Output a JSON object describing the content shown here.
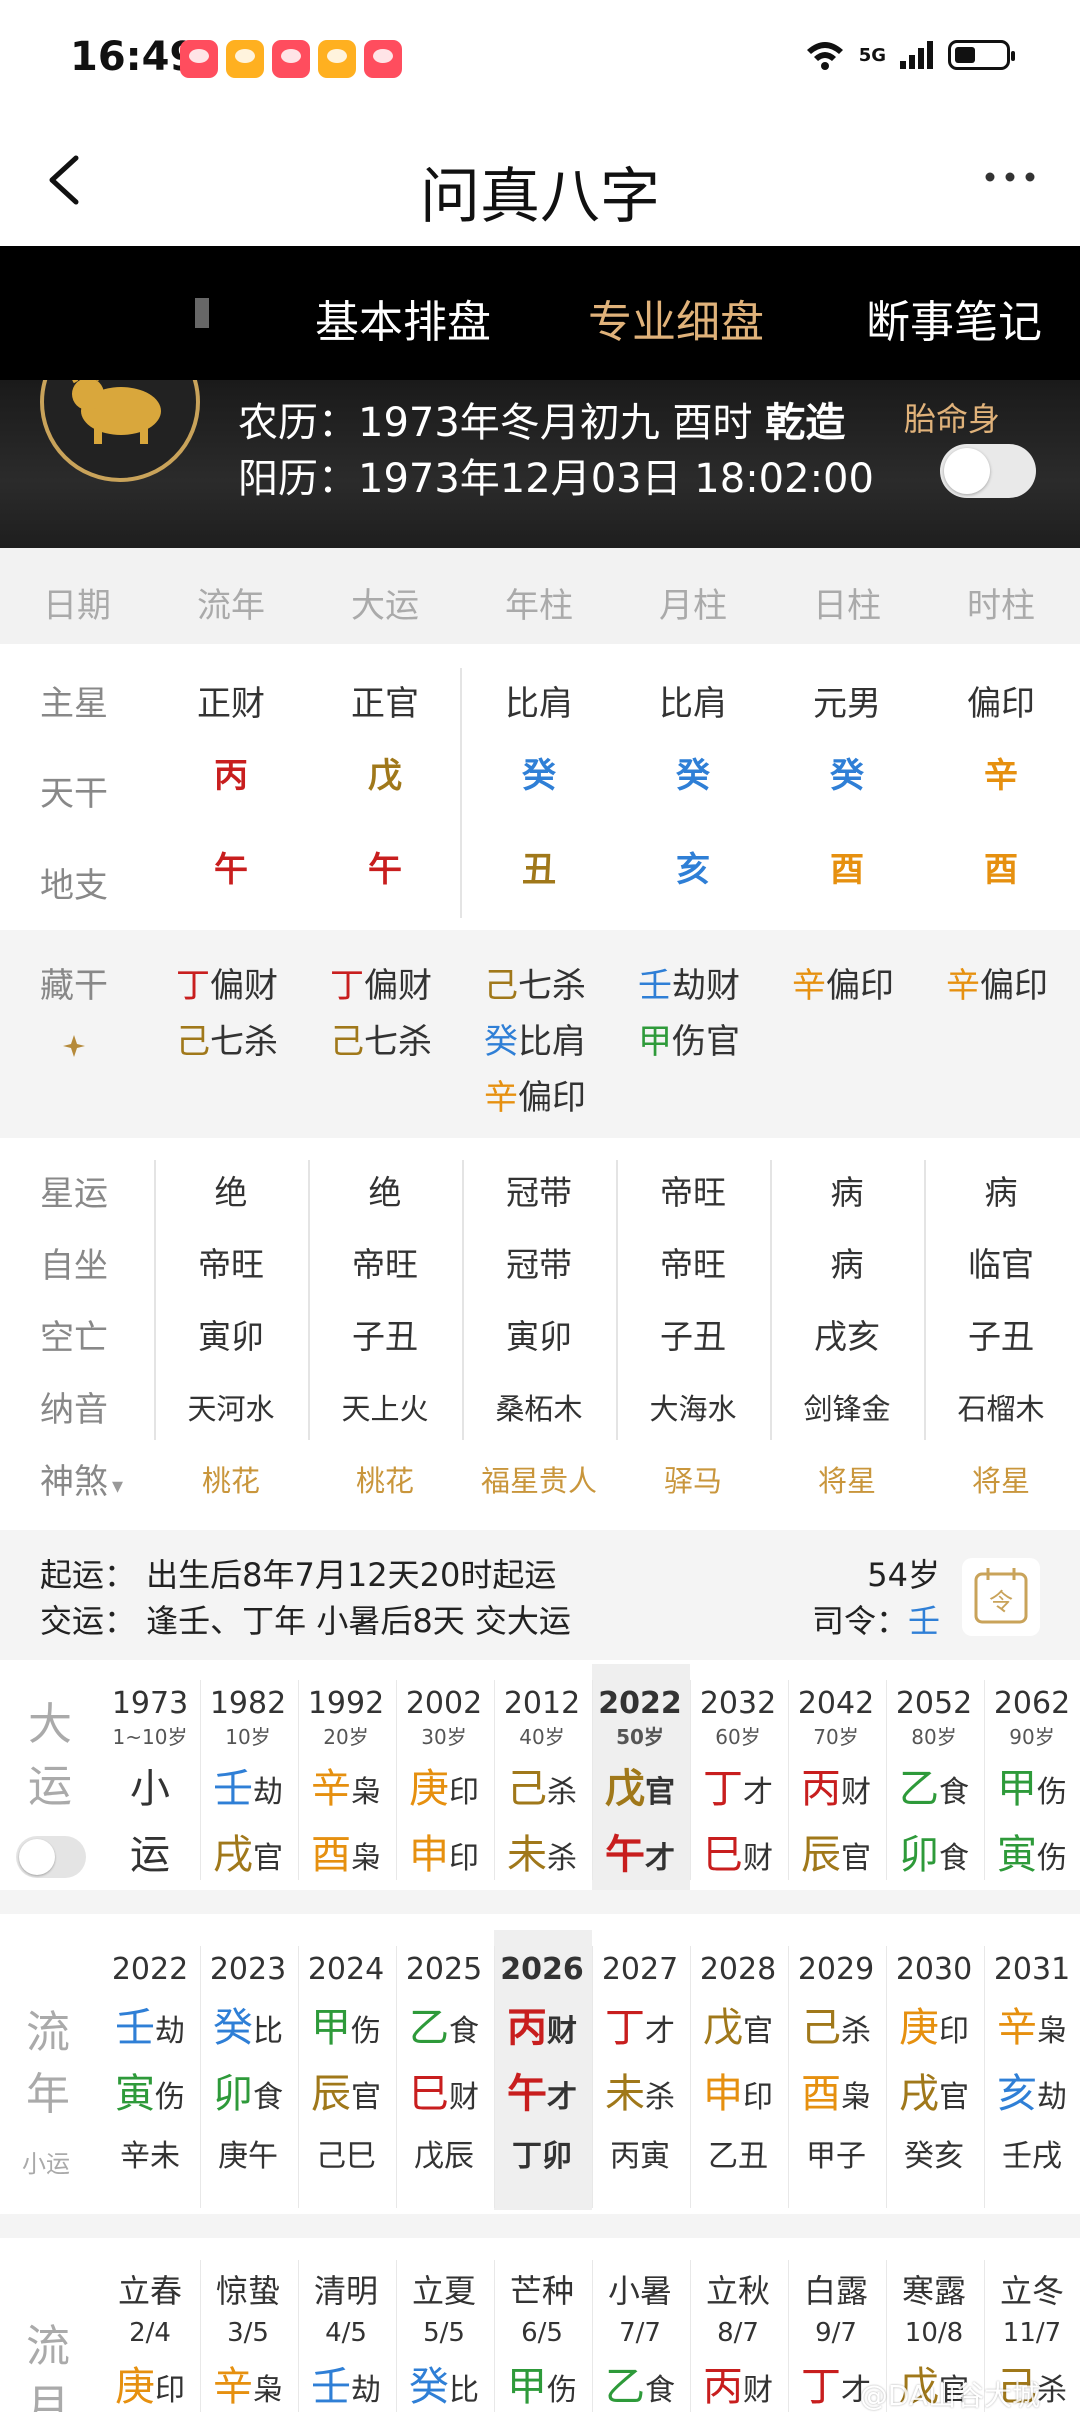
{
  "status": {
    "time": "16:49",
    "network": "5G"
  },
  "nav": {
    "title": "问真八字"
  },
  "tabs": [
    {
      "label": "基本排盘",
      "active": false
    },
    {
      "label": "专业细盘",
      "active": true
    },
    {
      "label": "断事笔记",
      "active": false
    }
  ],
  "header": {
    "lunar_prefix": "农历：1973年冬月初九 酉时 ",
    "lunar_sex": "乾造",
    "solar": "阳历：1973年12月03日 18:02:00",
    "taiming_label": "胎命身"
  },
  "pillars": {
    "headers": [
      "日期",
      "流年",
      "大运",
      "年柱",
      "月柱",
      "日柱",
      "时柱"
    ],
    "row_labels": {
      "zhuxing": "主星",
      "tiangan": "天干",
      "dizhi": "地支"
    },
    "zhuxing": [
      "正财",
      "正官",
      "比肩",
      "比肩",
      "元男",
      "偏印"
    ],
    "tiangan": [
      {
        "char": "丙",
        "color": "#c81e1e"
      },
      {
        "char": "戊",
        "color": "#a0781a"
      },
      {
        "char": "癸",
        "color": "#2f7fd6"
      },
      {
        "char": "癸",
        "color": "#2f7fd6"
      },
      {
        "char": "癸",
        "color": "#2f7fd6"
      },
      {
        "char": "辛",
        "color": "#e6900f"
      }
    ],
    "dizhi": [
      {
        "char": "午",
        "color": "#c81e1e"
      },
      {
        "char": "午",
        "color": "#c81e1e"
      },
      {
        "char": "丑",
        "color": "#a0781a"
      },
      {
        "char": "亥",
        "color": "#2f7fd6"
      },
      {
        "char": "酉",
        "color": "#e6900f"
      },
      {
        "char": "酉",
        "color": "#e6900f"
      }
    ]
  },
  "canggan": {
    "label": "藏干",
    "cols": [
      [
        {
          "g": "丁",
          "c": "#c81e1e",
          "t": "偏财"
        },
        {
          "g": "己",
          "c": "#a0781a",
          "t": "七杀"
        }
      ],
      [
        {
          "g": "丁",
          "c": "#c81e1e",
          "t": "偏财"
        },
        {
          "g": "己",
          "c": "#a0781a",
          "t": "七杀"
        }
      ],
      [
        {
          "g": "己",
          "c": "#a0781a",
          "t": "七杀"
        },
        {
          "g": "癸",
          "c": "#2f7fd6",
          "t": "比肩"
        },
        {
          "g": "辛",
          "c": "#e6900f",
          "t": "偏印"
        }
      ],
      [
        {
          "g": "壬",
          "c": "#2f7fd6",
          "t": "劫财"
        },
        {
          "g": "甲",
          "c": "#2e9a3a",
          "t": "伤官"
        }
      ],
      [
        {
          "g": "辛",
          "c": "#e6900f",
          "t": "偏印"
        }
      ],
      [
        {
          "g": "辛",
          "c": "#e6900f",
          "t": "偏印"
        }
      ]
    ]
  },
  "details": {
    "labels": [
      "星运",
      "自坐",
      "空亡",
      "纳音",
      "神煞"
    ],
    "xingyun": [
      "绝",
      "绝",
      "冠带",
      "帝旺",
      "病",
      "病"
    ],
    "zizuo": [
      "帝旺",
      "帝旺",
      "冠带",
      "帝旺",
      "病",
      "临官"
    ],
    "kongwang": [
      "寅卯",
      "子丑",
      "寅卯",
      "子丑",
      "戌亥",
      "子丑"
    ],
    "nayin": [
      "天河水",
      "天上火",
      "桑柘木",
      "大海水",
      "剑锋金",
      "石榴木"
    ],
    "shensha": [
      "桃花",
      "桃花",
      "福星贵人",
      "驿马",
      "将星",
      "将星"
    ]
  },
  "qiyun": {
    "line1": "起运：   出生后8年7月12天20时起运",
    "line2": "交运：   逢壬、丁年 小暑后8天 交大运",
    "age": "54岁",
    "siling_label": "司令：",
    "siling_value": "壬"
  },
  "dayun": {
    "label": [
      "大",
      "运"
    ],
    "cols": [
      {
        "year": "1973",
        "age": "1~10岁",
        "s": "小",
        "st": "",
        "sc": "#333",
        "b": "运",
        "bt": "",
        "bc": "#333"
      },
      {
        "year": "1982",
        "age": "10岁",
        "s": "壬",
        "st": "劫",
        "sc": "#2f7fd6",
        "b": "戌",
        "bt": "官",
        "bc": "#a0781a"
      },
      {
        "year": "1992",
        "age": "20岁",
        "s": "辛",
        "st": "枭",
        "sc": "#e6900f",
        "b": "酉",
        "bt": "枭",
        "bc": "#e6900f"
      },
      {
        "year": "2002",
        "age": "30岁",
        "s": "庚",
        "st": "印",
        "sc": "#e6900f",
        "b": "申",
        "bt": "印",
        "bc": "#e6900f"
      },
      {
        "year": "2012",
        "age": "40岁",
        "s": "己",
        "st": "杀",
        "sc": "#a0781a",
        "b": "未",
        "bt": "杀",
        "bc": "#a0781a"
      },
      {
        "year": "2022",
        "age": "50岁",
        "s": "戊",
        "st": "官",
        "sc": "#a0781a",
        "b": "午",
        "bt": "才",
        "bc": "#c81e1e",
        "current": true
      },
      {
        "year": "2032",
        "age": "60岁",
        "s": "丁",
        "st": "才",
        "sc": "#c81e1e",
        "b": "巳",
        "bt": "财",
        "bc": "#c81e1e"
      },
      {
        "year": "2042",
        "age": "70岁",
        "s": "丙",
        "st": "财",
        "sc": "#c81e1e",
        "b": "辰",
        "bt": "官",
        "bc": "#a0781a"
      },
      {
        "year": "2052",
        "age": "80岁",
        "s": "乙",
        "st": "食",
        "sc": "#2e9a3a",
        "b": "卯",
        "bt": "食",
        "bc": "#2e9a3a"
      },
      {
        "year": "2062",
        "age": "90岁",
        "s": "甲",
        "st": "伤",
        "sc": "#2e9a3a",
        "b": "寅",
        "bt": "伤",
        "bc": "#2e9a3a"
      }
    ]
  },
  "liunian": {
    "label": [
      "流",
      "年"
    ],
    "sublabel": "小运",
    "cols": [
      {
        "year": "2022",
        "s": "壬",
        "st": "劫",
        "sc": "#2f7fd6",
        "b": "寅",
        "bt": "伤",
        "bc": "#2e9a3a",
        "x": "辛未"
      },
      {
        "year": "2023",
        "s": "癸",
        "st": "比",
        "sc": "#2f7fd6",
        "b": "卯",
        "bt": "食",
        "bc": "#2e9a3a",
        "x": "庚午"
      },
      {
        "year": "2024",
        "s": "甲",
        "st": "伤",
        "sc": "#2e9a3a",
        "b": "辰",
        "bt": "官",
        "bc": "#a0781a",
        "x": "己巳"
      },
      {
        "year": "2025",
        "s": "乙",
        "st": "食",
        "sc": "#2e9a3a",
        "b": "巳",
        "bt": "财",
        "bc": "#c81e1e",
        "x": "戊辰"
      },
      {
        "year": "2026",
        "s": "丙",
        "st": "财",
        "sc": "#c81e1e",
        "b": "午",
        "bt": "才",
        "bc": "#c81e1e",
        "x": "丁卯",
        "current": true
      },
      {
        "year": "2027",
        "s": "丁",
        "st": "才",
        "sc": "#c81e1e",
        "b": "未",
        "bt": "杀",
        "bc": "#a0781a",
        "x": "丙寅"
      },
      {
        "year": "2028",
        "s": "戊",
        "st": "官",
        "sc": "#a0781a",
        "b": "申",
        "bt": "印",
        "bc": "#e6900f",
        "x": "乙丑"
      },
      {
        "year": "2029",
        "s": "己",
        "st": "杀",
        "sc": "#a0781a",
        "b": "酉",
        "bt": "枭",
        "bc": "#e6900f",
        "x": "甲子"
      },
      {
        "year": "2030",
        "s": "庚",
        "st": "印",
        "sc": "#e6900f",
        "b": "戌",
        "bt": "官",
        "bc": "#a0781a",
        "x": "癸亥"
      },
      {
        "year": "2031",
        "s": "辛",
        "st": "枭",
        "sc": "#e6900f",
        "b": "亥",
        "bt": "劫",
        "bc": "#2f7fd6",
        "x": "壬戌"
      }
    ]
  },
  "liuyue": {
    "label": [
      "流",
      "月"
    ],
    "cols": [
      {
        "term": "立春",
        "date": "2/4",
        "s": "庚",
        "st": "印",
        "sc": "#e6900f"
      },
      {
        "term": "惊蛰",
        "date": "3/5",
        "s": "辛",
        "st": "枭",
        "sc": "#e6900f"
      },
      {
        "term": "清明",
        "date": "4/5",
        "s": "壬",
        "st": "劫",
        "sc": "#2f7fd6"
      },
      {
        "term": "立夏",
        "date": "5/5",
        "s": "癸",
        "st": "比",
        "sc": "#2f7fd6"
      },
      {
        "term": "芒种",
        "date": "6/5",
        "s": "甲",
        "st": "伤",
        "sc": "#2e9a3a"
      },
      {
        "term": "小暑",
        "date": "7/7",
        "s": "乙",
        "st": "食",
        "sc": "#2e9a3a"
      },
      {
        "term": "立秋",
        "date": "8/7",
        "s": "丙",
        "st": "财",
        "sc": "#c81e1e"
      },
      {
        "term": "白露",
        "date": "9/7",
        "s": "丁",
        "st": "才",
        "sc": "#c81e1e"
      },
      {
        "term": "寒露",
        "date": "10/8",
        "s": "戊",
        "st": "官",
        "sc": "#a0781a"
      },
      {
        "term": "立冬",
        "date": "11/7",
        "s": "己",
        "st": "杀",
        "sc": "#a0781a"
      }
    ]
  },
  "watermark": "@DA山谷大城"
}
